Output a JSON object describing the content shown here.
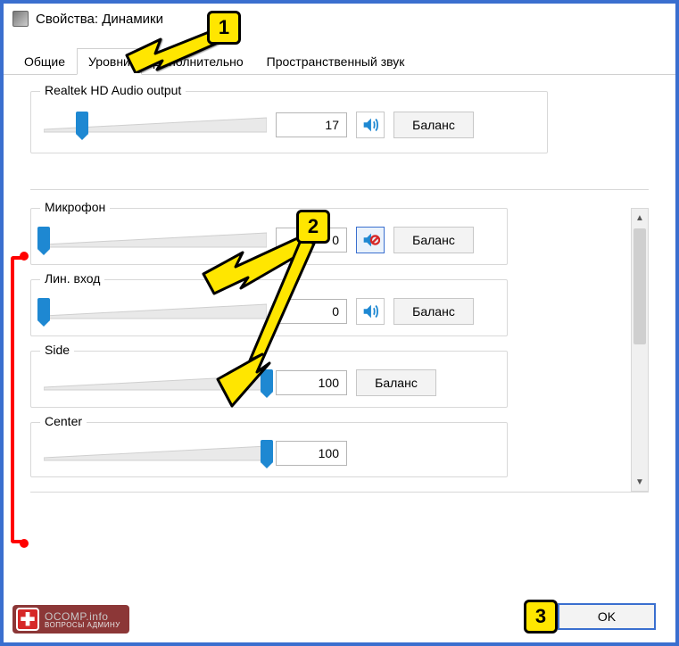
{
  "window": {
    "title": "Свойства: Динамики"
  },
  "tabs": {
    "general": "Общие",
    "levels": "Уровни",
    "advanced": "Дополнительно",
    "spatial": "Пространственный звук",
    "active": "levels"
  },
  "output": {
    "label": "Realtek HD Audio output",
    "value": "17",
    "value_num": 17,
    "balance": "Баланс"
  },
  "channels": [
    {
      "label": "Микрофон",
      "value": "0",
      "value_num": 0,
      "muted": true,
      "show_mute": true,
      "show_balance": true,
      "balance": "Баланс"
    },
    {
      "label": "Лин. вход",
      "value": "0",
      "value_num": 0,
      "muted": false,
      "show_mute": true,
      "show_balance": true,
      "balance": "Баланс"
    },
    {
      "label": "Side",
      "value": "100",
      "value_num": 100,
      "muted": false,
      "show_mute": false,
      "show_balance": true,
      "balance": "Баланс"
    },
    {
      "label": "Center",
      "value": "100",
      "value_num": 100,
      "muted": false,
      "show_mute": false,
      "show_balance": false
    }
  ],
  "buttons": {
    "ok": "OK"
  },
  "annotations": {
    "1": "1",
    "2": "2",
    "3": "3"
  },
  "watermark": {
    "brand": "OCOMP",
    "suffix": ".info",
    "tagline": "ВОПРОСЫ АДМИНУ"
  }
}
